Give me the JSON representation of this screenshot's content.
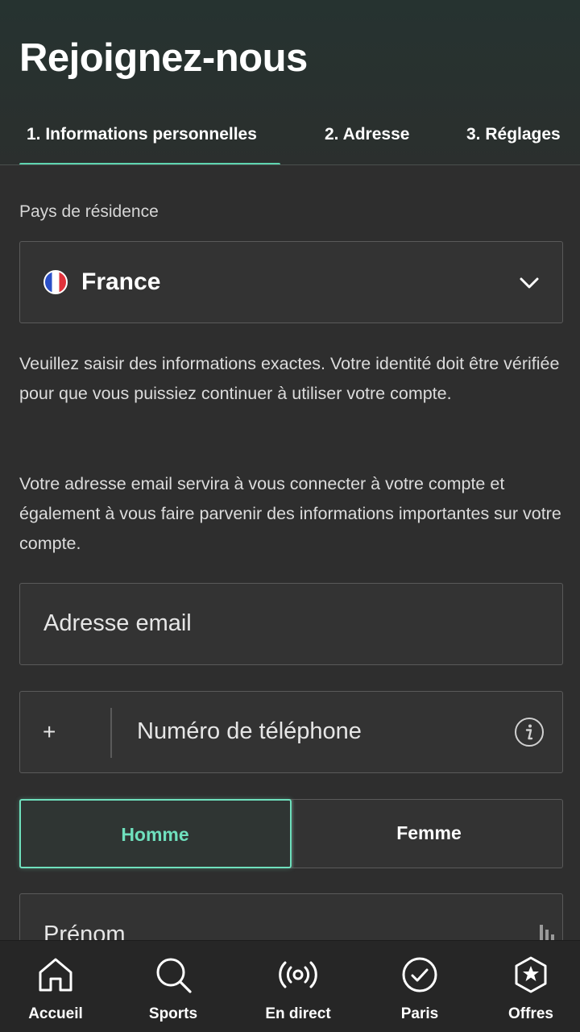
{
  "header": {
    "title": "Rejoignez-nous",
    "tabs": [
      {
        "label": "1.  Informations personnelles",
        "active": true
      },
      {
        "label": "2.  Adresse",
        "active": false
      },
      {
        "label": "3.  Réglages",
        "active": false
      }
    ]
  },
  "form": {
    "country_label": "Pays de résidence",
    "country_value": "France",
    "country_icon": "france-flag-icon",
    "info_text_1": "Veuillez saisir des informations exactes. Votre identité doit être vérifiée pour que vous puissiez continuer à utiliser votre compte.",
    "info_text_2": "Votre adresse email servira à vous connecter à votre compte et également à vous faire parvenir des informations importantes sur votre compte.",
    "email_placeholder": "Adresse email",
    "phone_prefix": "+",
    "phone_placeholder": "Numéro de téléphone",
    "gender_options": [
      {
        "label": "Homme",
        "selected": true
      },
      {
        "label": "Femme",
        "selected": false
      }
    ],
    "firstname_placeholder": "Prénom"
  },
  "bottom_nav": [
    {
      "label": "Accueil",
      "icon": "home-icon"
    },
    {
      "label": "Sports",
      "icon": "search-icon"
    },
    {
      "label": "En direct",
      "icon": "live-broadcast-icon"
    },
    {
      "label": "Paris",
      "icon": "check-circle-icon"
    },
    {
      "label": "Offres",
      "icon": "star-badge-icon"
    }
  ],
  "colors": {
    "accent": "#5fd4b0",
    "background": "#2e2e2e",
    "nav_background": "#262626"
  }
}
